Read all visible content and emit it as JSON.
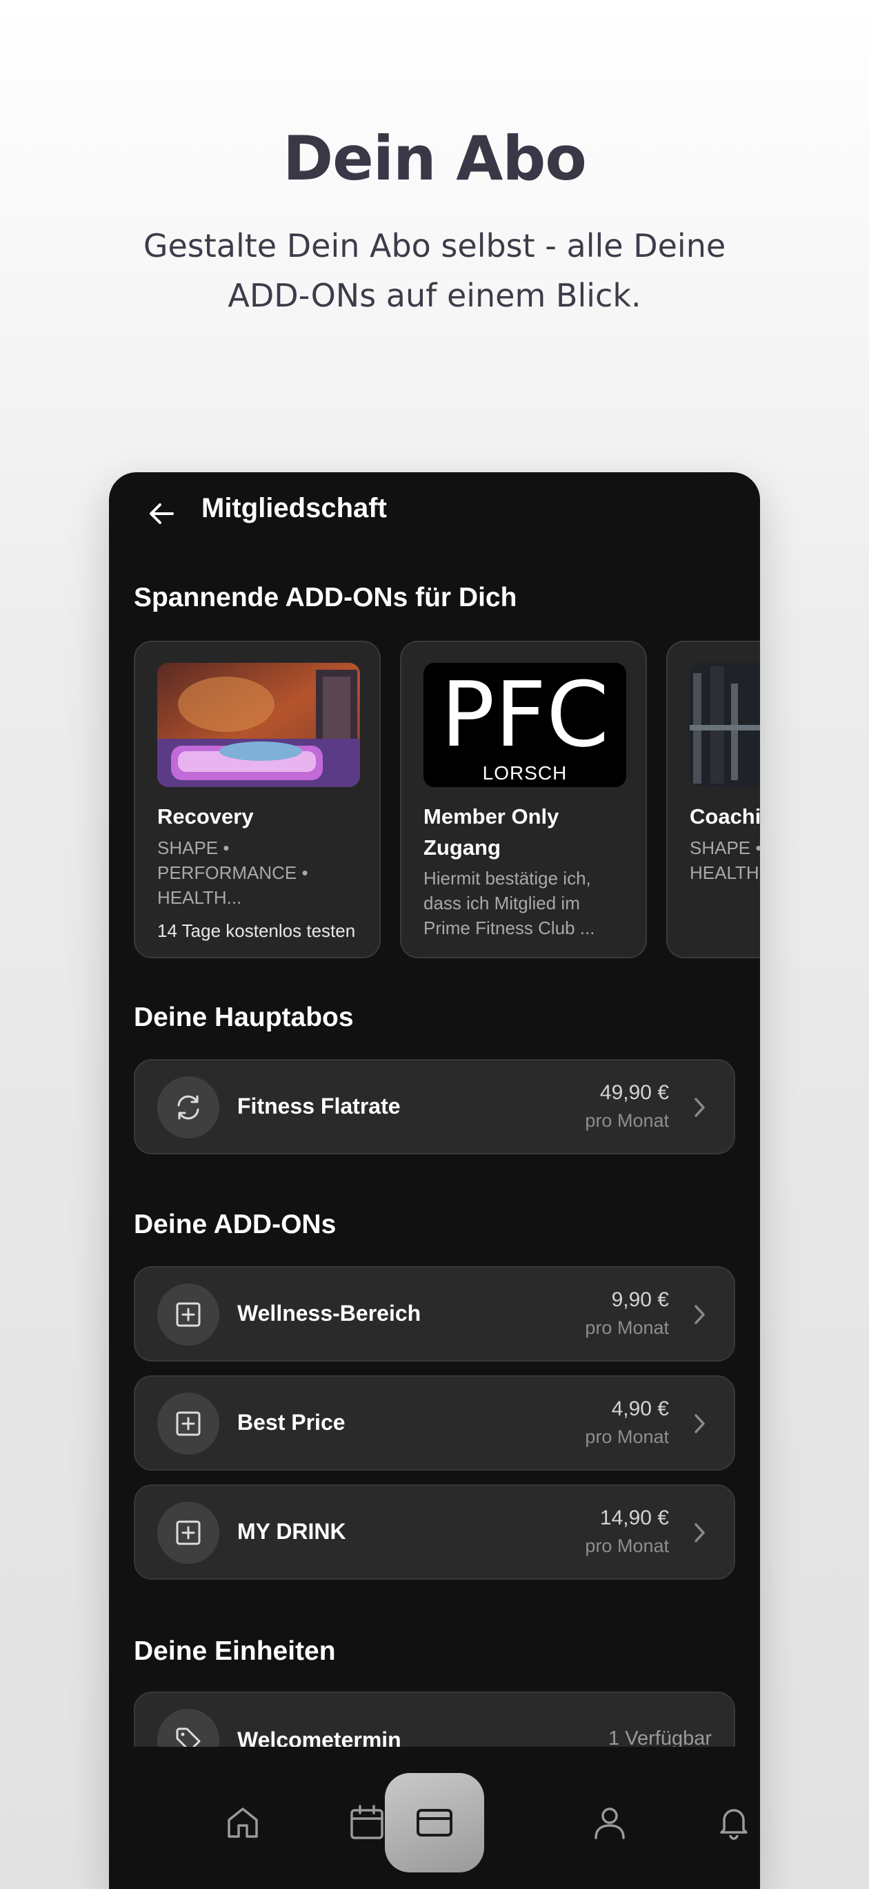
{
  "hero": {
    "title": "Dein Abo",
    "subtitle": "Gestalte Dein Abo selbst - alle Deine ADD-ONs auf einem Blick."
  },
  "app_bar": {
    "back_icon": "arrow-left-icon",
    "title": "Mitgliedschaft"
  },
  "addons_section": {
    "title": "Spannende ADD-ONs für Dich",
    "cards": [
      {
        "title": "Recovery",
        "description": "SHAPE • PERFORMANCE • HEALTH...",
        "note": "14 Tage kostenlos testen",
        "image": "recovery-room-photo"
      },
      {
        "title": " Member Only Zugang",
        "description": "Hiermit bestätige ich, dass ich Mitglied im Prime Fitness Club ...",
        "image": "pfc-logo",
        "logo_main": "PFC",
        "logo_sub": "LORSCH"
      },
      {
        "title": "Coachi",
        "description": "SHAPE • PERFOR HEALTH",
        "image": "gym-photo"
      }
    ]
  },
  "main_subs": {
    "title": "Deine Hauptabos",
    "items": [
      {
        "label": "Fitness Flatrate",
        "price": "49,90 €",
        "period": "pro Monat",
        "icon": "refresh-icon"
      }
    ]
  },
  "addons": {
    "title": "Deine ADD-ONs",
    "items": [
      {
        "label": "Wellness-Bereich",
        "price": "9,90 €",
        "period": "pro Monat",
        "icon": "plus-square-icon"
      },
      {
        "label": "Best Price",
        "price": "4,90 €",
        "period": "pro Monat",
        "icon": "plus-square-icon"
      },
      {
        "label": "MY DRINK",
        "price": "14,90 €",
        "period": "pro Monat",
        "icon": "plus-square-icon"
      }
    ]
  },
  "units": {
    "title": "Deine Einheiten",
    "items": [
      {
        "label": "Welcometermin",
        "availability": "1 Verfügbar",
        "icon": "tag-icon"
      }
    ]
  },
  "nav": {
    "items": [
      "home-icon",
      "calendar-icon",
      "card-icon",
      "user-icon",
      "bell-icon"
    ],
    "active": "card-icon"
  },
  "colors": {
    "background": "#111111",
    "card": "#2a2a2a",
    "text": "#ffffff",
    "muted": "#8e8e8e",
    "hero_text": "#393847"
  }
}
